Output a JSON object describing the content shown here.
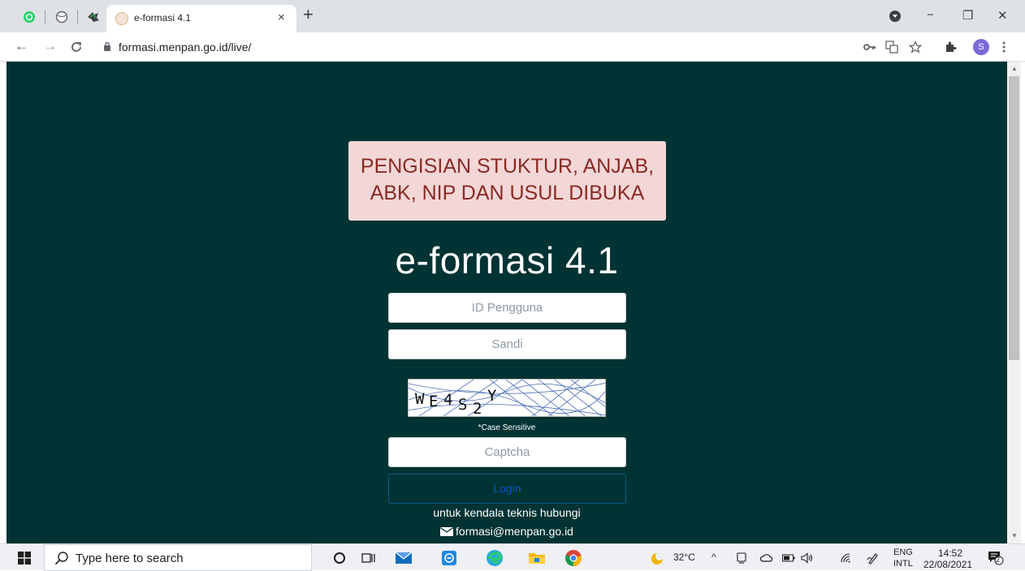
{
  "browser": {
    "tab_title": "e-formasi 4.1",
    "tab_close": "×",
    "new_tab": "+",
    "url": "formasi.menpan.go.id/live/",
    "profile_initial": "S",
    "window_controls": {
      "minimize": "−",
      "restore": "❐",
      "close": "✕"
    },
    "nav": {
      "back": "←",
      "forward": "→",
      "reload": "C"
    }
  },
  "page": {
    "notice_line1": "PENGISIAN STUKTUR, ANJAB,",
    "notice_line2": "ABK, NIP DAN USUL DIBUKA",
    "app_title": "e-formasi 4.1",
    "username_placeholder": "ID Pengguna",
    "password_placeholder": "Sandi",
    "captcha_text": "WE4S2Y",
    "case_note": "*Case Sensitive",
    "captcha_placeholder": "Captcha",
    "login_label": "Login",
    "help_text": "untuk kendala teknis hubungi",
    "email": "formasi@menpan.go.id"
  },
  "taskbar": {
    "search_placeholder": "Type here to search",
    "temperature": "32°C",
    "language_top": "ENG",
    "language_bottom": "INTL",
    "time": "14:52",
    "date": "22/08/2021",
    "notification_count": "2"
  },
  "colors": {
    "page_bg": "#003333",
    "notice_bg": "#f3d7d7",
    "notice_text": "#8b2a25",
    "login_text": "#0a58ca"
  }
}
